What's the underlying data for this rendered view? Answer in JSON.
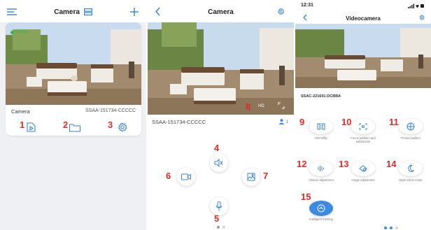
{
  "panel1": {
    "header": {
      "title": "Camera",
      "menu_icon": "hamburger-icon",
      "layout_icon": "grid-layout-icon",
      "add_icon": "plus-icon"
    },
    "card": {
      "status": "Online",
      "name": "Camera",
      "device_id": "SSAA-151734-CCCCC",
      "actions": [
        {
          "icon": "playback-file-icon",
          "number": "1"
        },
        {
          "icon": "folder-icon",
          "number": "2"
        },
        {
          "icon": "gear-icon",
          "number": "3"
        }
      ]
    }
  },
  "panel2": {
    "header": {
      "title": "Camera",
      "back_icon": "chevron-left-icon",
      "settings_icon": "gear-icon"
    },
    "overlay": {
      "quality": "HD",
      "number": "8"
    },
    "device_id": "SSAA-151734-CCCCC",
    "viewer_count": "1",
    "controls": [
      {
        "icon": "speaker-icon",
        "number": "4"
      },
      {
        "icon": "video-record-icon",
        "number": "6"
      },
      {
        "icon": "snapshot-icon",
        "number": "7"
      },
      {
        "icon": "microphone-icon",
        "number": "5"
      }
    ]
  },
  "panel3": {
    "status": {
      "time": "12:31"
    },
    "header": {
      "title": "Videocamera",
      "back_icon": "chevron-left-icon",
      "settings_icon": "gear-icon"
    },
    "device_id": "SSAC-221691-DCBBA",
    "functions": [
      {
        "label": "Mirror/flip",
        "number": "9",
        "icon": "mirror-flip-icon"
      },
      {
        "label": "Focus addition and subtraction",
        "number": "10",
        "icon": "focus-icon"
      },
      {
        "label": "Preset position",
        "number": "11",
        "icon": "preset-icon"
      },
      {
        "label": "Volume adjustment",
        "number": "12",
        "icon": "volume-icon"
      },
      {
        "label": "Image adjustment",
        "number": "13",
        "icon": "image-adjust-icon"
      },
      {
        "label": "Night vision mode",
        "number": "14",
        "icon": "moon-icon"
      },
      {
        "label": "Intelligent tracking",
        "number": "15",
        "icon": "tracking-icon"
      }
    ]
  },
  "colors": {
    "accent": "#3d8ae0",
    "online": "#2fb94a",
    "annotation": "#e02a2a",
    "icon": "#3b82c4"
  }
}
